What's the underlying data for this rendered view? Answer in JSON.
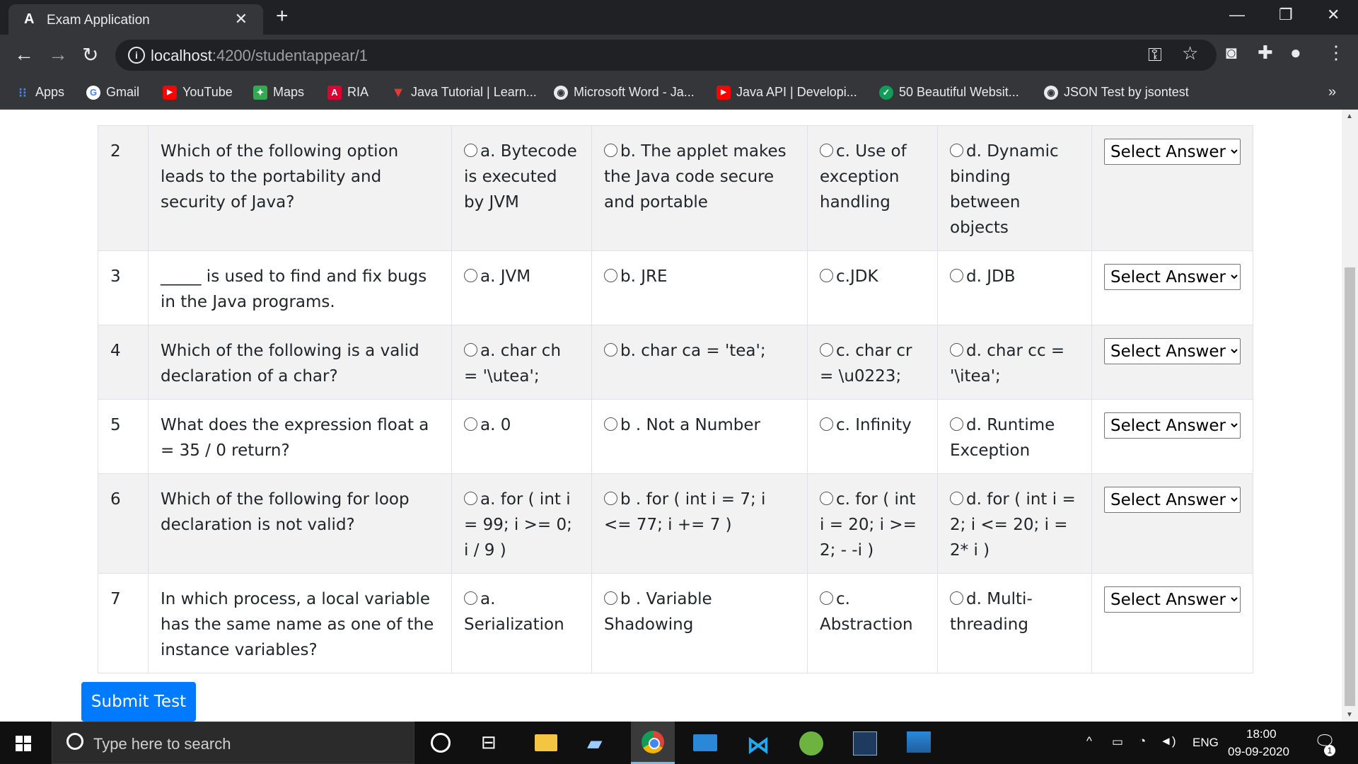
{
  "browser": {
    "tab_title": "Exam Application",
    "url_host": "localhost",
    "url_path": ":4200/studentappear/1",
    "bookmarks": [
      {
        "label": "Apps"
      },
      {
        "label": "Gmail"
      },
      {
        "label": "YouTube"
      },
      {
        "label": "Maps"
      },
      {
        "label": "RIA"
      },
      {
        "label": "Java Tutorial | Learn..."
      },
      {
        "label": "Microsoft Word - Ja..."
      },
      {
        "label": "Java API | Developi..."
      },
      {
        "label": "50 Beautiful Websit..."
      },
      {
        "label": "JSON Test by jsontest"
      }
    ]
  },
  "questions": [
    {
      "no": "2",
      "text": "Which of the following option leads to the portability and security of Java?",
      "a": "a. Bytecode is executed by JVM",
      "b": "b. The applet makes the Java code secure and portable",
      "c": "c. Use of exception handling",
      "d": "d. Dynamic binding between objects",
      "select": "Select Answer"
    },
    {
      "no": "3",
      "text": "_____ is used to find and fix bugs in the Java programs.",
      "a": "a. JVM",
      "b": "b. JRE",
      "c": "c.JDK",
      "d": "d. JDB",
      "select": "Select Answer"
    },
    {
      "no": "4",
      "text": "Which of the following is a valid declaration of a char?",
      "a": "a. char ch = '\\utea';",
      "b": "b. char ca = 'tea';",
      "c": "c. char cr = \\u0223;",
      "d": "d. char cc = '\\itea';",
      "select": "Select Answer"
    },
    {
      "no": "5",
      "text": "What does the expression float a = 35 / 0 return?",
      "a": "a. 0",
      "b": "b . Not a Number",
      "c": "c. Infinity",
      "d": "d. Runtime Exception",
      "select": "Select Answer"
    },
    {
      "no": "6",
      "text": "Which of the following for loop declaration is not valid?",
      "a": "a. for ( int i = 99; i >= 0; i / 9 )",
      "b": "b . for ( int i = 7; i <= 77; i += 7 )",
      "c": "c. for ( int i = 20; i >= 2; - -i )",
      "d": "d. for ( int i = 2; i <= 20; i = 2* i )",
      "select": "Select Answer"
    },
    {
      "no": "7",
      "text": "In which process, a local variable has the same name as one of the instance variables?",
      "a": "a. Serialization",
      "b": "b . Variable Shadowing",
      "c": "c. Abstraction",
      "d": "d. Multi-threading",
      "select": "Select Answer"
    }
  ],
  "submit_label": "Submit Test",
  "taskbar": {
    "search_placeholder": "Type here to search",
    "time": "18:00",
    "date": "09-09-2020",
    "lang": "ENG",
    "notification_count": "1"
  },
  "colors": {
    "primary": "#007bff",
    "stripe": "#f2f2f2",
    "chrome_dark": "#202124",
    "chrome": "#35363a"
  }
}
